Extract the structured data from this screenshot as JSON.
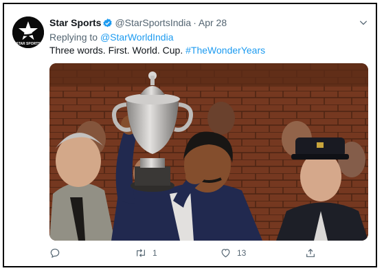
{
  "tweet": {
    "author_name": "Star Sports",
    "handle": "@StarSportsIndia",
    "separator": "·",
    "date": "Apr 28",
    "replying_prefix": "Replying to",
    "replying_to": "@StarWorldIndia",
    "text": "Three words. First. World. Cup.",
    "hashtag": "#TheWonderYears",
    "avatar_text": "STAR SPORTS"
  },
  "actions": {
    "reply_count": "",
    "retweet_count": "1",
    "like_count": "13",
    "share_count": ""
  },
  "icons": [
    "verified-badge-icon",
    "chevron-down-icon",
    "reply-icon",
    "retweet-icon",
    "like-icon",
    "share-icon",
    "star-logo-icon"
  ],
  "colors": {
    "accent": "#1d9bf0",
    "text_primary": "#0f1419",
    "text_secondary": "#536471",
    "frame_border": "#000000"
  }
}
